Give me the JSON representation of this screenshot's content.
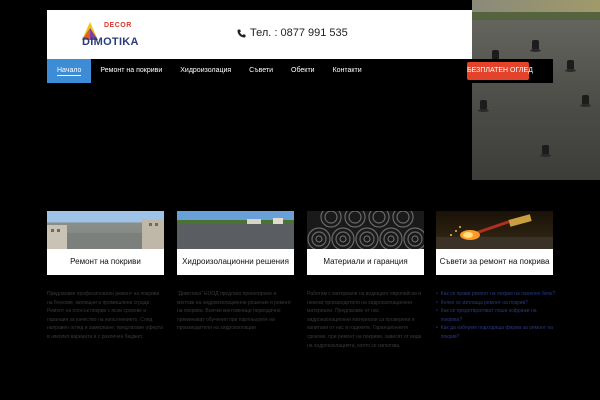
{
  "header": {
    "logo": {
      "decor": "DECOR",
      "brand": "DIMOTIKA"
    },
    "phone": "Тел. : 0877 991 535"
  },
  "nav": {
    "items": [
      "Начало",
      "Ремонт на покриви",
      "Хидроизолация",
      "Съвети",
      "Обекти",
      "Контакти"
    ],
    "cta": "БЕЗПЛАТЕН ОГЛЕД"
  },
  "cards": [
    {
      "title": "Ремонт на покриви"
    },
    {
      "title": "Хидроизолационни решения"
    },
    {
      "title": "Материали и гаранция"
    },
    {
      "title": "Съвети за ремонт на покрива"
    }
  ],
  "descriptions": [
    "Предлагаме професионален ремонт на покриви на блокове, жилищни и промишлени сгради. Ремонт на плосък покрив с ясни срокове и гаранция за качество на изпълнението. След направен оглед и замерване, предлагаме оферта в няколко варианта и с различен бюджет.",
    "“Димотика” ЕООД предлага проектиране и монтаж на хидроизолационни решения и ремонт на покриви. Всички монтажници периодично преминават обучения при партньорите ни производители на хидроизолации",
    "Работим с материали на водещите европейски и немски производители на хидроизолационни материали. Предлагаме от нас хидроизолационни материали са проверени и изпитани от нас в годините. Гаранционните срокове, при ремонт на покриви, зависят от вида на хидроизолацията, която се използва."
  ],
  "links": [
    "Как се прави ремонт на покрив на панелен блок?",
    "Колко се изплаща ремонт на покрив?",
    "Как се предотвратяват лоши кофражи на покрива?",
    "Как да изберем подходяща фирма за ремонт на покрив?"
  ],
  "colors": {
    "accent_blue": "#3c8dd6",
    "cta_red": "#e2432a",
    "brand_navy": "#2a3d7a"
  }
}
